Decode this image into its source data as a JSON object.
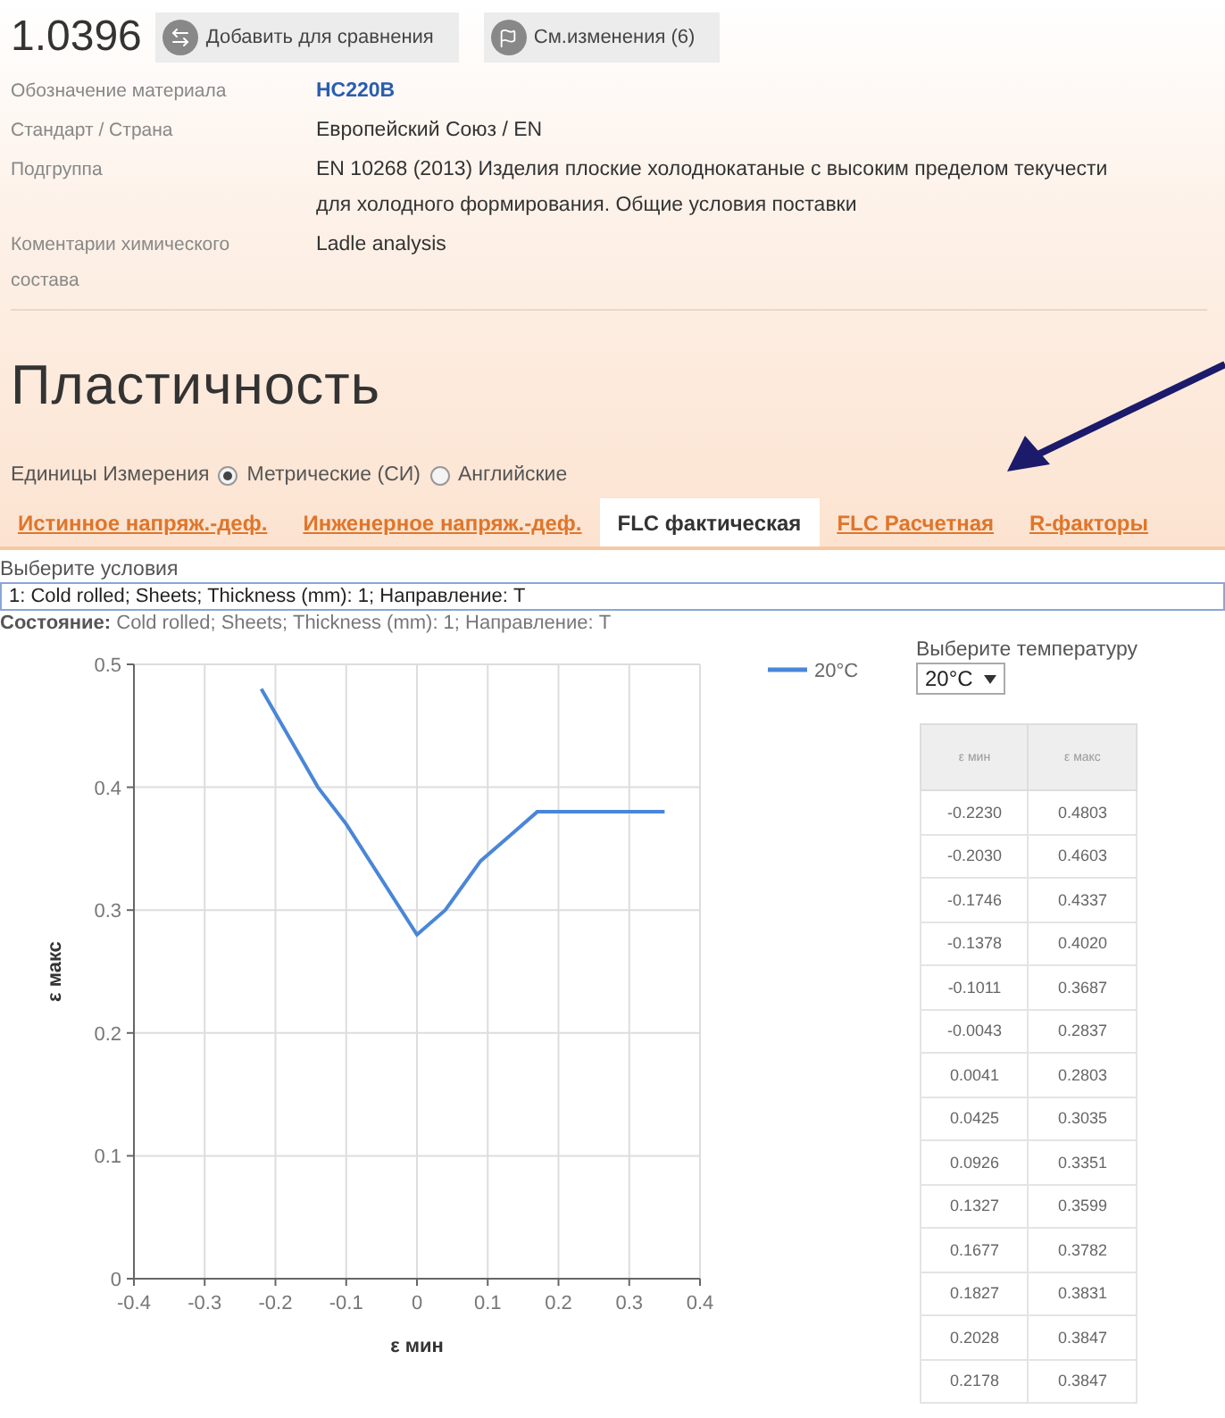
{
  "header": {
    "code": "1.0396",
    "buttons": [
      {
        "label": "Добавить для сравнения",
        "kind": "compare"
      },
      {
        "label": "См.изменения (6)",
        "kind": "changes"
      }
    ]
  },
  "properties": [
    {
      "label": "Обозначение материала",
      "value": "HC220B",
      "kind": "link"
    },
    {
      "label": "Стандарт / Страна",
      "value": "Европейский Союз / EN",
      "kind": "text"
    },
    {
      "label": "Подгруппа",
      "value": "EN 10268 (2013) Изделия плоские холоднокатаные с высоким пределом текучести для холодного формирования. Общие условия поставки",
      "kind": "text"
    },
    {
      "label": "Коментарии химического состава",
      "value": "Ladle analysis",
      "kind": "text"
    }
  ],
  "section_title": "Пластичность",
  "units": {
    "label": "Единицы Измерения",
    "options": [
      {
        "label": "Метрические (СИ)",
        "selected": true
      },
      {
        "label": "Английские",
        "selected": false
      }
    ]
  },
  "tabs": [
    {
      "label": "Истинное напряж.-деф.",
      "selected": false
    },
    {
      "label": "Инженерное напряж.-деф.",
      "selected": false
    },
    {
      "label": "FLC фактическая",
      "selected": true
    },
    {
      "label": "FLC Расчетная",
      "selected": false
    },
    {
      "label": "R-факторы",
      "selected": false
    }
  ],
  "conditions": {
    "label": "Выберите условия",
    "value": "1: Cold rolled; Sheets; Thickness (mm): 1; Направление: T",
    "status": "**Состояние:**  Cold rolled; Sheets; Thickness (mm): 1; Направление: T"
  },
  "chart_data": {
    "type": "line",
    "xlabel": "ε мин",
    "ylabel": "ε макс",
    "x": [
      -0.22,
      -0.2,
      -0.17,
      -0.14,
      -0.1,
      0,
      0,
      0.04,
      0.09,
      0.13,
      0.17,
      0.18,
      0.2,
      0.22,
      0.35
    ],
    "series": [
      {
        "name": "20°C",
        "color": "#4a86d8",
        "values": [
          0.48,
          0.46,
          0.43,
          0.4,
          0.37,
          0.28,
          0.28,
          0.3,
          0.34,
          0.36,
          0.38,
          0.38,
          0.38,
          0.38,
          0.38
        ]
      }
    ],
    "grid": true,
    "xlim": [
      -0.4,
      0.4
    ],
    "ylim": [
      0,
      0.5
    ],
    "xticks": [
      -0.4,
      -0.3,
      -0.2,
      -0.1,
      0,
      0.1,
      0.2,
      0.3,
      0.4
    ],
    "yticks": [
      0,
      0.1,
      0.2,
      0.3,
      0.4,
      0.5
    ]
  },
  "temperature": {
    "label": "Выберите температуру",
    "value": "20°C"
  },
  "table": {
    "columns": [
      "ε мин",
      "ε макс"
    ],
    "rows": [
      [
        "-0.2230",
        "0.4803"
      ],
      [
        "-0.2030",
        "0.4603"
      ],
      [
        "-0.1746",
        "0.4337"
      ],
      [
        "-0.1378",
        "0.4020"
      ],
      [
        "-0.1011",
        "0.3687"
      ],
      [
        "-0.0043",
        "0.2837"
      ],
      [
        "0.0041",
        "0.2803"
      ],
      [
        "0.0425",
        "0.3035"
      ],
      [
        "0.0926",
        "0.3351"
      ],
      [
        "0.1327",
        "0.3599"
      ],
      [
        "0.1677",
        "0.3782"
      ],
      [
        "0.1827",
        "0.3831"
      ],
      [
        "0.2028",
        "0.3847"
      ],
      [
        "0.2178",
        "0.3847"
      ]
    ]
  }
}
